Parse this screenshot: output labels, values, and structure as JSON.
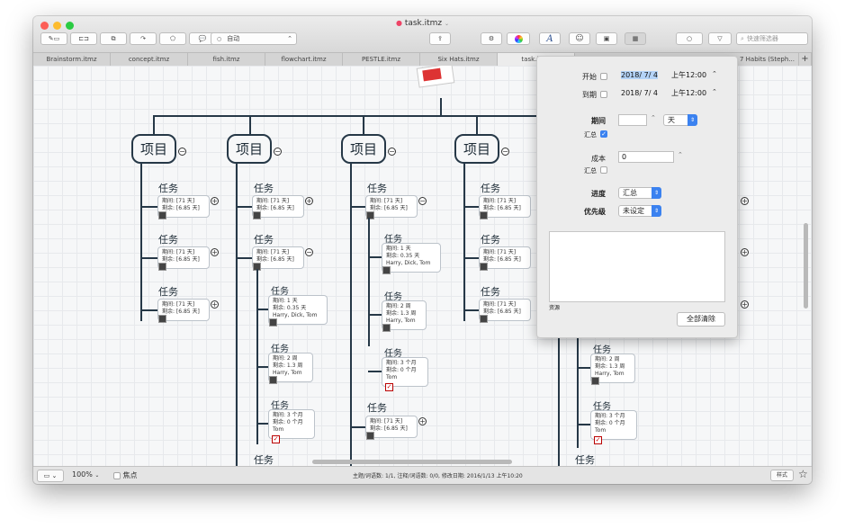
{
  "window": {
    "title": "task.itmz"
  },
  "toolbar": {
    "style_select": "自动",
    "search_placeholder": "快速筛选器"
  },
  "tabs": [
    "Brainstorm.itmz",
    "concept.itmz",
    "fish.itmz",
    "flowchart.itmz",
    "PESTLE.itmz",
    "Six Hats.itmz",
    "task.itmz",
    "7 Habits (Steph..."
  ],
  "map": {
    "project_label": "项目",
    "task_label": "任务",
    "box_a": {
      "line1": "期间: [71 天]",
      "line2": "剩余: [6.85 天]"
    },
    "box_b": {
      "line1": "期间: 1 天",
      "line2": "剩余: 0.35 天",
      "line3": "Harry, Dick, Tom"
    },
    "box_c": {
      "line1": "期间: 2 周",
      "line2": "剩余: 1.3 周",
      "line3": "Harry, Tom"
    },
    "box_d": {
      "line1": "期间: 3 个月",
      "line2": "剩余: 0 个月",
      "line3": "Tom"
    }
  },
  "popover": {
    "start_label": "开始",
    "start_date": "2018/ 7/ 4",
    "start_time": "上午12:00",
    "due_label": "到期",
    "due_date": "2018/ 7/ 4",
    "due_time": "上午12:00",
    "duration_label": "期间",
    "duration_unit": "天",
    "rollup_label": "汇总",
    "cost_label": "成本",
    "cost_value": "0",
    "cost_rollup_label": "汇总",
    "progress_label": "进度",
    "progress_value": "汇总",
    "priority_label": "优先级",
    "priority_value": "未设定",
    "resources_label": "资源",
    "clear_button": "全部清除"
  },
  "statusbar": {
    "zoom": "100%",
    "focus_label": "焦点",
    "info": "主题/词语数: 1/1, 注释/词语数: 0/0, 修改日期: 2016/1/13 上午10:20",
    "style_button": "样式"
  }
}
